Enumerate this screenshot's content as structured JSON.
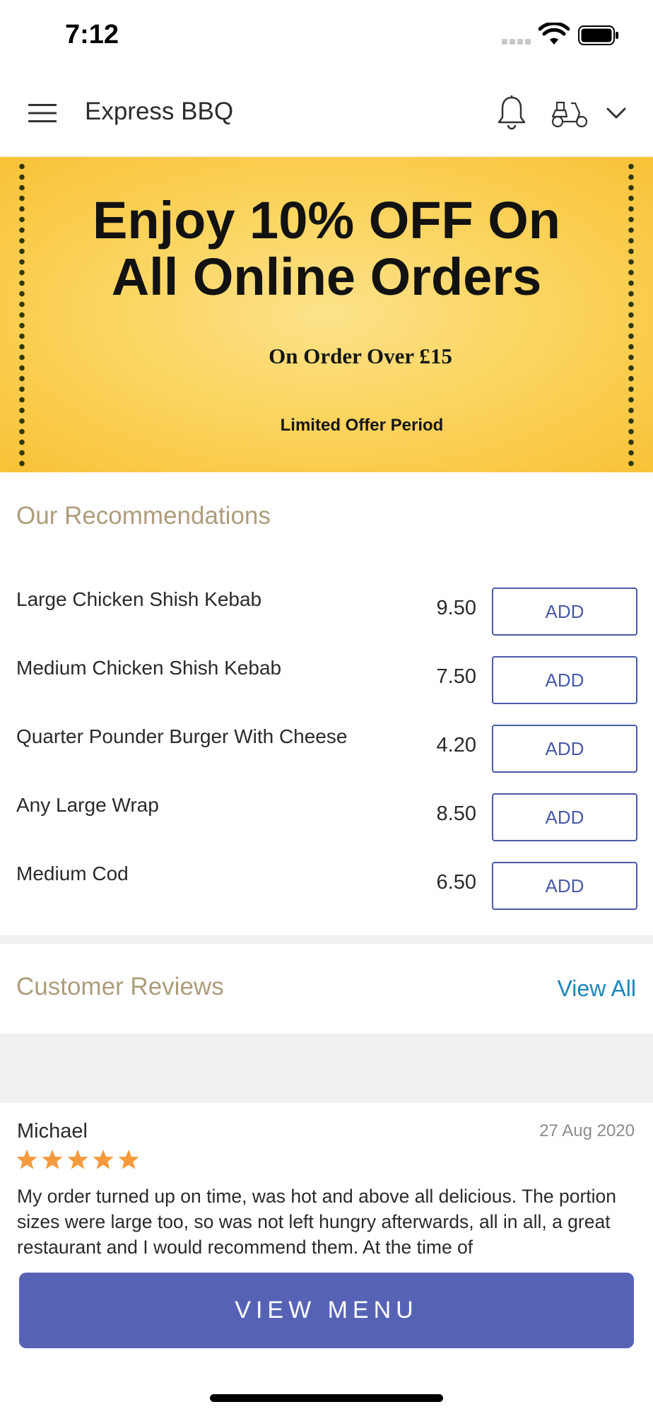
{
  "status_bar": {
    "time": "7:12"
  },
  "header": {
    "title": "Express BBQ"
  },
  "banner": {
    "headline_line1": "Enjoy 10% OFF On",
    "headline_line2": "All Online Orders",
    "subtext": "On Order Over £15",
    "note": "Limited Offer Period"
  },
  "recommendations": {
    "title": "Our Recommendations",
    "add_label": "ADD",
    "items": [
      {
        "name": "Large Chicken Shish Kebab",
        "price": "9.50"
      },
      {
        "name": "Medium Chicken Shish Kebab",
        "price": "7.50"
      },
      {
        "name": "Quarter Pounder Burger With Cheese",
        "price": "4.20"
      },
      {
        "name": "Any Large Wrap",
        "price": "8.50"
      },
      {
        "name": "Medium Cod",
        "price": "6.50"
      }
    ]
  },
  "reviews": {
    "title": "Customer Reviews",
    "view_all": "View All",
    "items": [
      {
        "name": "Michael",
        "date": "27 Aug 2020",
        "rating": 5,
        "text": "My order turned up on time, was hot and above all delicious. The portion sizes were large too, so was not left hungry afterwards, all in all, a great restaurant and I would recommend them. At the time of"
      }
    ]
  },
  "cta": {
    "label": "VIEW MENU"
  },
  "colors": {
    "accent": "#5663b5",
    "section_title": "#ad9d7c",
    "link": "#1b86bb",
    "star": "#f59a3c"
  },
  "icons": [
    "menu-icon",
    "bell-icon",
    "scooter-icon",
    "chevron-down-icon",
    "star-icon",
    "wifi-icon",
    "battery-icon"
  ]
}
